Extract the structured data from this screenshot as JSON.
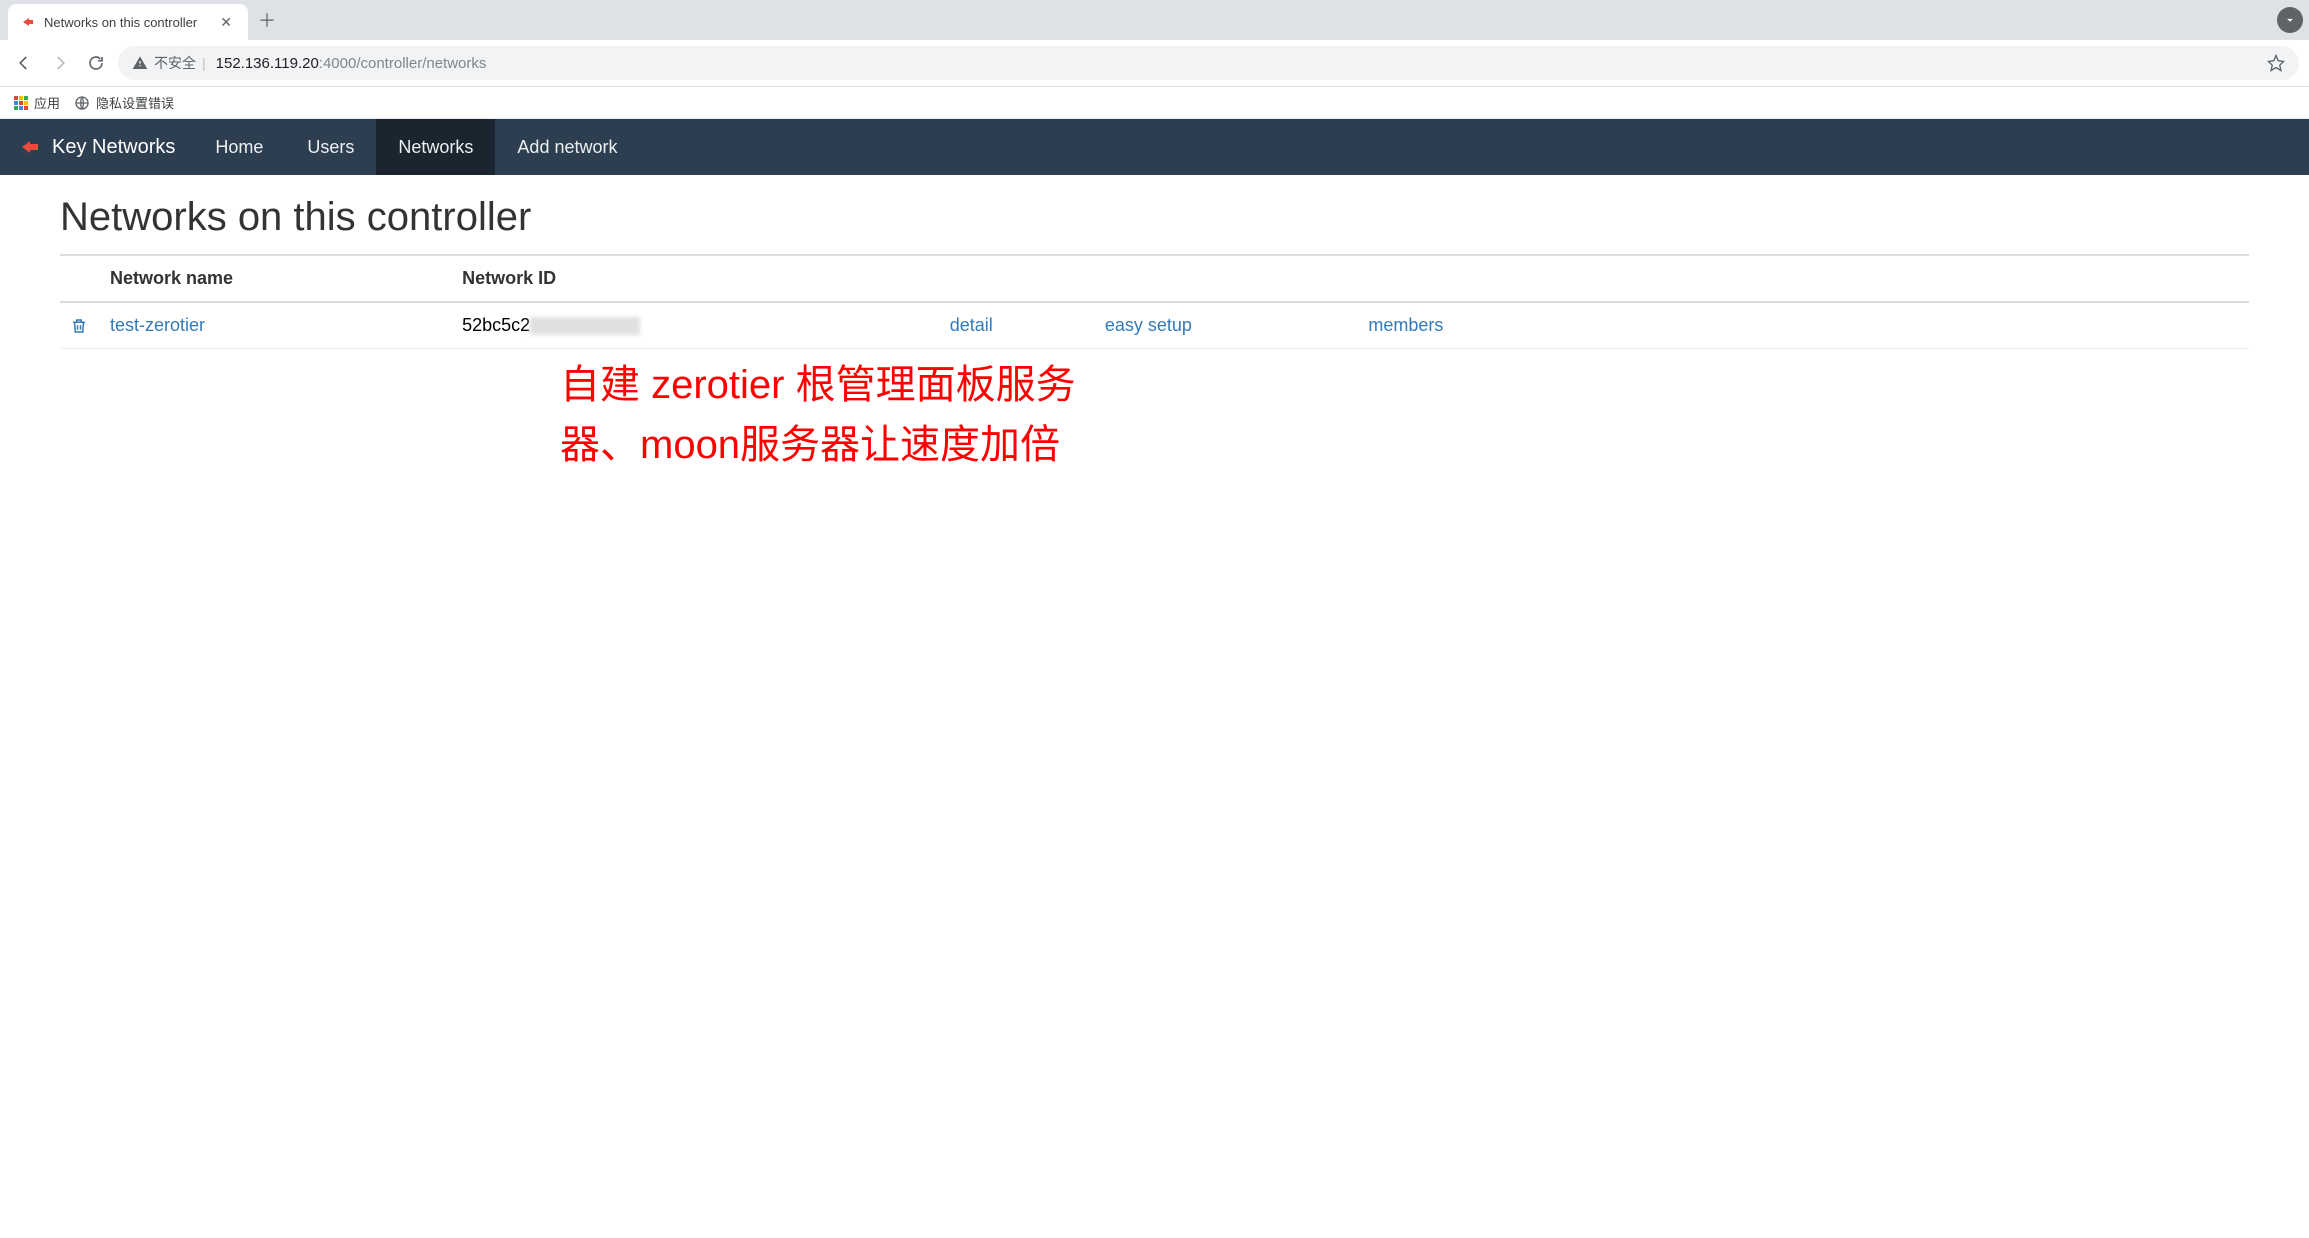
{
  "browser": {
    "tab_title": "Networks on this controller",
    "security_label": "不安全",
    "url_host": "152.136.119.20",
    "url_port_path": ":4000/controller/networks",
    "bookmarks": {
      "apps": "应用",
      "privacy_error": "隐私设置错误"
    }
  },
  "nav": {
    "brand": "Key Networks",
    "items": [
      {
        "label": "Home",
        "active": false
      },
      {
        "label": "Users",
        "active": false
      },
      {
        "label": "Networks",
        "active": true
      },
      {
        "label": "Add network",
        "active": false
      }
    ]
  },
  "page": {
    "title": "Networks on this controller",
    "columns": {
      "name": "Network name",
      "id": "Network ID"
    },
    "rows": [
      {
        "name": "test-zerotier",
        "id_prefix": "52bc5c2",
        "actions": {
          "detail": "detail",
          "easy_setup": "easy setup",
          "members": "members"
        }
      }
    ]
  },
  "annotation": {
    "line1": "自建 zerotier 根管理面板服务",
    "line2": "器、moon服务器让速度加倍"
  }
}
